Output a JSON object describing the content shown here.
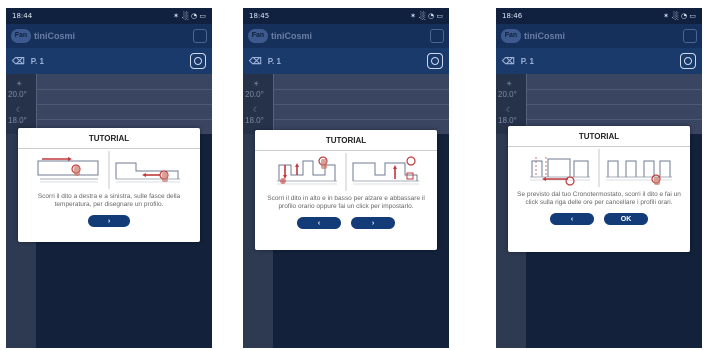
{
  "screens": [
    {
      "status": {
        "time": "18:44",
        "indicators": "✶ .░ ◔ ▭"
      },
      "app": {
        "brand": "tiniCosmi",
        "logo": "Fan"
      },
      "toolbar": {
        "program": "P. 1"
      },
      "temps": {
        "high": "20.0°",
        "low": "18.0°"
      },
      "tutorial": {
        "title": "TUTORIAL",
        "text": "Scorri il dito a destra e a sinistra, sulle fasce della temperatura, per disegnare un profilo.",
        "buttons": [
          "›"
        ]
      }
    },
    {
      "status": {
        "time": "18:45",
        "indicators": "✶ .░ ◔ ▭"
      },
      "app": {
        "brand": "tiniCosmi",
        "logo": "Fan"
      },
      "toolbar": {
        "program": "P. 1"
      },
      "temps": {
        "high": "20.0°",
        "low": "18.0°"
      },
      "tutorial": {
        "title": "TUTORIAL",
        "text": "Scorri il dito in alto e in basso per alzare e abbassare il profilo orario oppure fai un click per impostarlo.",
        "buttons": [
          "‹",
          "›"
        ]
      }
    },
    {
      "status": {
        "time": "18:46",
        "indicators": "✶ .░ ◔ ▭"
      },
      "app": {
        "brand": "tiniCosmi",
        "logo": "Fan"
      },
      "toolbar": {
        "program": "P. 1"
      },
      "temps": {
        "high": "20.0°",
        "low": "18.0°"
      },
      "tutorial": {
        "title": "TUTORIAL",
        "text": "Se previsto dal tuo Cronotermostato, scorri il dito e fai un click sulla riga delle ore per cancellare i profili orari.",
        "buttons": [
          "‹",
          "OK"
        ]
      }
    }
  ],
  "colors": {
    "accent": "#123b78",
    "appbar": "#15305a",
    "dialog": "#ffffff",
    "illustration_red": "#c0393b"
  }
}
